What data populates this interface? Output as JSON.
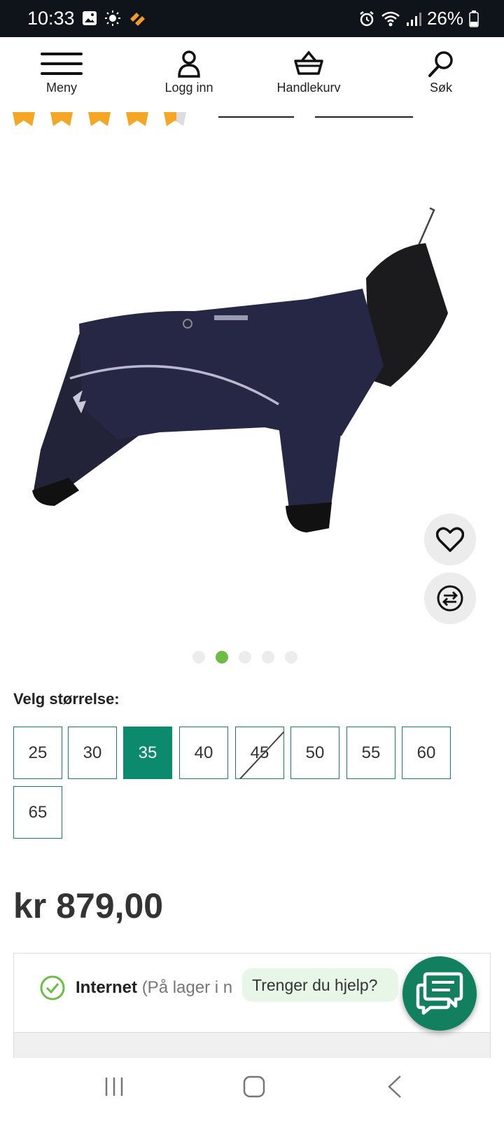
{
  "status_bar": {
    "time": "10:33",
    "battery": "26%"
  },
  "nav": {
    "items": [
      {
        "label": "Meny",
        "icon": "menu-icon"
      },
      {
        "label": "Logg inn",
        "icon": "user-icon"
      },
      {
        "label": "Handlekurv",
        "icon": "basket-icon"
      },
      {
        "label": "Søk",
        "icon": "search-icon"
      }
    ]
  },
  "rating": {
    "stars": 4.5,
    "max": 5
  },
  "gallery": {
    "image_count": 5,
    "active_index": 1
  },
  "size_picker": {
    "title": "Velg størrelse:",
    "sizes": [
      {
        "label": "25",
        "state": "available"
      },
      {
        "label": "30",
        "state": "available"
      },
      {
        "label": "35",
        "state": "selected"
      },
      {
        "label": "40",
        "state": "available"
      },
      {
        "label": "45",
        "state": "unavailable"
      },
      {
        "label": "50",
        "state": "available"
      },
      {
        "label": "55",
        "state": "available"
      },
      {
        "label": "60",
        "state": "available"
      },
      {
        "label": "65",
        "state": "available"
      }
    ]
  },
  "price": "kr 879,00",
  "stock": {
    "channel": "Internet",
    "status": "(På lager i n"
  },
  "help": {
    "text": "Trenger du hjelp?"
  },
  "colors": {
    "accent": "#0c8a6d",
    "star": "#f5a623",
    "dot_active": "#6bbd45",
    "chat": "#12805f"
  }
}
